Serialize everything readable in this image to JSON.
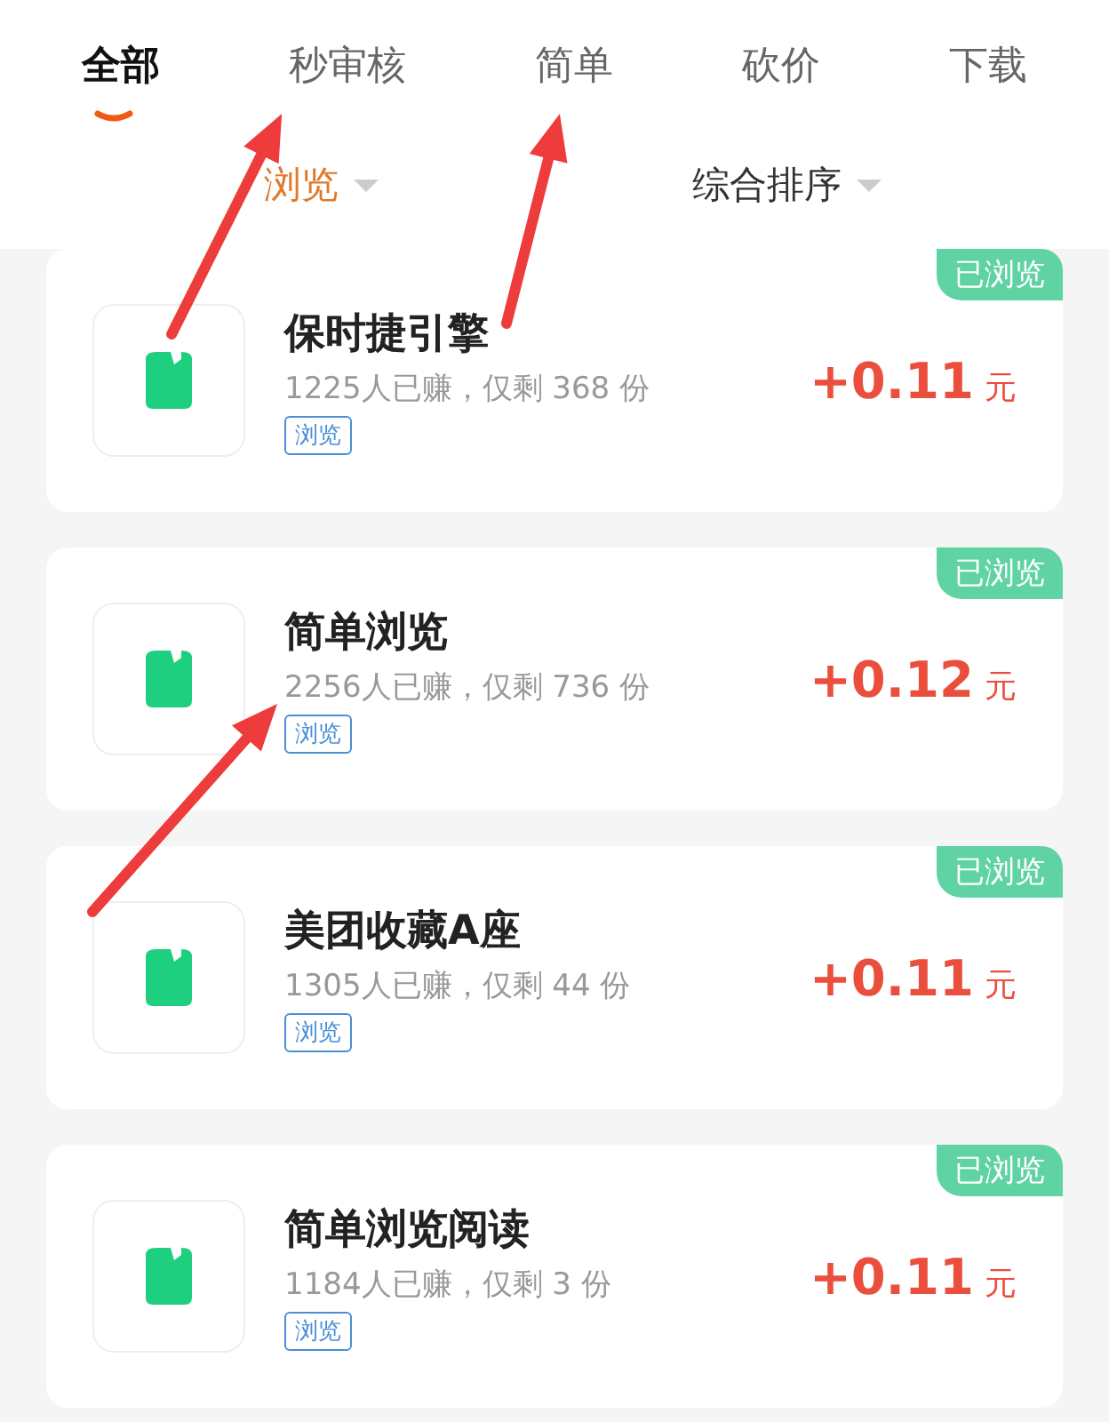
{
  "tabs": [
    {
      "label": "全部",
      "selected": true,
      "arrow": false
    },
    {
      "label": "秒审核",
      "selected": false,
      "arrow": true
    },
    {
      "label": "简单",
      "selected": false,
      "arrow": true
    },
    {
      "label": "砍价",
      "selected": false,
      "arrow": false
    },
    {
      "label": "下载",
      "selected": false,
      "arrow": false
    }
  ],
  "filters": [
    {
      "label": "浏览",
      "selected": true
    },
    {
      "label": "综合排序",
      "selected": false
    }
  ],
  "tasks": [
    {
      "title": "保时捷引擎",
      "stats": "1225人已赚，仅剩 368 份",
      "tag": "浏览",
      "amount": "+0.11",
      "unit": "元",
      "badge": "已浏览",
      "arrow": false
    },
    {
      "title": "简单浏览",
      "stats": "2256人已赚，仅剩 736 份",
      "tag": "浏览",
      "amount": "+0.12",
      "unit": "元",
      "badge": "已浏览",
      "arrow": true
    },
    {
      "title": "美团收藏A座",
      "stats": "1305人已赚，仅剩 44 份",
      "tag": "浏览",
      "amount": "+0.11",
      "unit": "元",
      "badge": "已浏览",
      "arrow": false
    },
    {
      "title": "简单浏览阅读",
      "stats": "1184人已赚，仅剩 3 份",
      "tag": "浏览",
      "amount": "+0.11",
      "unit": "元",
      "badge": "已浏览",
      "arrow": false
    }
  ]
}
